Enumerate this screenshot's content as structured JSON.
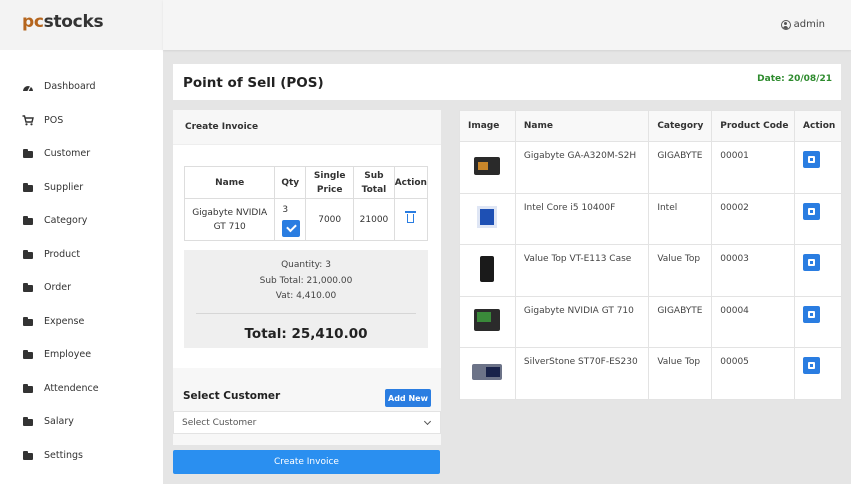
{
  "brand": {
    "pc": "pc",
    "rest": "stocks"
  },
  "user": {
    "name": "admin"
  },
  "sidebar": {
    "items": [
      {
        "label": "Dashboard",
        "icon": "tachometer-icon"
      },
      {
        "label": "POS",
        "icon": "cart-icon"
      },
      {
        "label": "Customer",
        "icon": "folder-icon"
      },
      {
        "label": "Supplier",
        "icon": "folder-icon"
      },
      {
        "label": "Category",
        "icon": "folder-icon"
      },
      {
        "label": "Product",
        "icon": "folder-icon"
      },
      {
        "label": "Order",
        "icon": "folder-icon"
      },
      {
        "label": "Expense",
        "icon": "folder-icon"
      },
      {
        "label": "Employee",
        "icon": "folder-icon"
      },
      {
        "label": "Attendence",
        "icon": "folder-icon"
      },
      {
        "label": "Salary",
        "icon": "folder-icon"
      },
      {
        "label": "Settings",
        "icon": "folder-icon"
      }
    ]
  },
  "header": {
    "title": "Point of Sell (POS)",
    "date": "Date: 20/08/21"
  },
  "invoice": {
    "heading": "Create Invoice",
    "columns": [
      "Name",
      "Qty",
      "Single Price",
      "Sub Total",
      "Action"
    ],
    "rows": [
      {
        "name": "Gigabyte NVIDIA GT 710",
        "qty": "3",
        "price": "7000",
        "subtotal": "21000"
      }
    ],
    "summary": {
      "quantity": "Quantity: 3",
      "subtotal": "Sub Total: 21,000.00",
      "vat": "Vat: 4,410.00",
      "total": "Total: 25,410.00"
    }
  },
  "customer": {
    "label": "Select Customer",
    "add_button": "Add New",
    "select_value": "Select Customer"
  },
  "create_button": "Create Invoice",
  "products": {
    "columns": [
      "Image",
      "Name",
      "Category",
      "Product Code",
      "Action"
    ],
    "rows": [
      {
        "name": "Gigabyte GA-A320M-S2H",
        "category": "GIGABYTE",
        "code": "00001",
        "thumb": "motherboard-image"
      },
      {
        "name": "Intel Core i5 10400F",
        "category": "Intel",
        "code": "00002",
        "thumb": "cpu-box-image"
      },
      {
        "name": "Value Top VT-E113 Case",
        "category": "Value Top",
        "code": "00003",
        "thumb": "pc-case-image"
      },
      {
        "name": "Gigabyte NVIDIA GT 710",
        "category": "GIGABYTE",
        "code": "00004",
        "thumb": "graphics-card-image"
      },
      {
        "name": "SilverStone ST70F-ES230",
        "category": "Value Top",
        "code": "00005",
        "thumb": "power-supply-image"
      }
    ]
  },
  "colors": {
    "accent": "#2a7de1",
    "date": "#2e8b2e",
    "brand_pc": "#b5651d"
  }
}
